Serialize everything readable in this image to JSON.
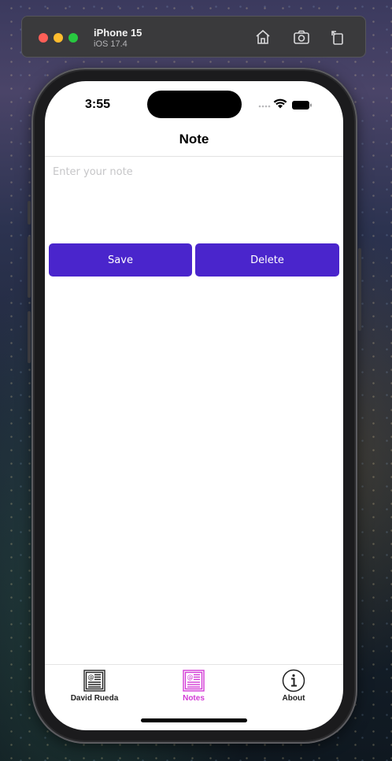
{
  "simulator": {
    "device_name": "iPhone 15",
    "os_version": "iOS 17.4",
    "toolbar_icons": [
      "home-icon",
      "screenshot-icon",
      "rotate-icon"
    ]
  },
  "status_bar": {
    "time": "3:55",
    "icons": [
      "signal-dots-icon",
      "wifi-icon",
      "battery-icon"
    ]
  },
  "nav": {
    "title": "Note"
  },
  "editor": {
    "placeholder": "Enter your note",
    "value": ""
  },
  "actions": {
    "save_label": "Save",
    "delete_label": "Delete",
    "button_color": "#4a25cc"
  },
  "tabs": [
    {
      "label": "David Rueda",
      "icon": "newspaper-icon",
      "selected": false
    },
    {
      "label": "Notes",
      "icon": "newspaper-icon",
      "selected": true
    },
    {
      "label": "About",
      "icon": "info-icon",
      "selected": false
    }
  ],
  "colors": {
    "tab_selected": "#d23ad6",
    "tab_default": "#222222"
  }
}
